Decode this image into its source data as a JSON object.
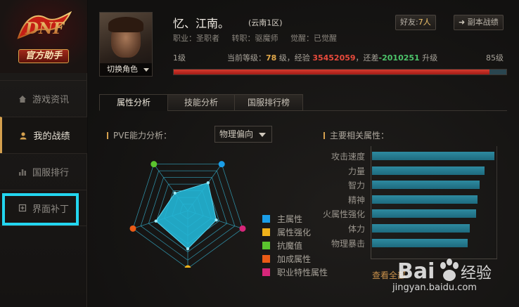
{
  "sidebar": {
    "logo_main": "官方助手",
    "items": [
      {
        "label": "游戏资讯",
        "icon": "home-icon"
      },
      {
        "label": "我的战绩",
        "icon": "user-icon"
      },
      {
        "label": "国服排行",
        "icon": "rank-icon"
      },
      {
        "label": "界面补丁",
        "icon": "patch-icon"
      }
    ],
    "active_index": 1,
    "highlight_color": "#23d6f0"
  },
  "character": {
    "name": "忆、江南。",
    "server": "(云南1区)",
    "switch_label": "切换角色",
    "profession": "职业：圣职者",
    "advance": "转职：驱魔师",
    "awaken": "觉醒：已觉醒"
  },
  "header_buttons": {
    "friends_prefix": "好友:",
    "friends_count": "7人",
    "dungeon_record": "副本战绩"
  },
  "level": {
    "min_label": "1级",
    "current_prefix": "当前等级：",
    "current_level": "78",
    "level_unit": "级，经验",
    "exp": "35452059",
    "remain_prefix": "，还差",
    "remain": "-2010251",
    "upgrade_suffix": "升级",
    "max_label": "85级",
    "exp_progress": 0.95
  },
  "tabs": [
    {
      "label": "属性分析",
      "active": true
    },
    {
      "label": "技能分析",
      "active": false
    },
    {
      "label": "国服排行榜",
      "active": false
    }
  ],
  "pve": {
    "title": "PVE能力分析：",
    "select_value": "物理偏向"
  },
  "radar_legend": [
    {
      "label": "主属性",
      "color": "#1a9ee8"
    },
    {
      "label": "属性强化",
      "color": "#f0b21a"
    },
    {
      "label": "抗魔值",
      "color": "#5ac42e"
    },
    {
      "label": "加成属性",
      "color": "#ea5a16"
    },
    {
      "label": "职业特性属性",
      "color": "#d6267a"
    }
  ],
  "radar_values": {
    "主属性": 0.6,
    "职业特性属性": 0.52,
    "属性强化": 0.66,
    "加成属性": 0.58,
    "抗魔值": 0.38
  },
  "radar_fill_color": "#22b6d6",
  "related": {
    "title": "主要相关属性：",
    "items": [
      {
        "label": "攻击速度",
        "value": 1.0
      },
      {
        "label": "力量",
        "value": 0.92
      },
      {
        "label": "智力",
        "value": 0.88
      },
      {
        "label": "精神",
        "value": 0.86
      },
      {
        "label": "火属性强化",
        "value": 0.85
      },
      {
        "label": "体力",
        "value": 0.8
      },
      {
        "label": "物理暴击",
        "value": 0.78
      }
    ],
    "more_link": "查看全部"
  },
  "watermark": {
    "brand": "Bai",
    "brand2": "经验",
    "url": "jingyan.baidu.com"
  }
}
